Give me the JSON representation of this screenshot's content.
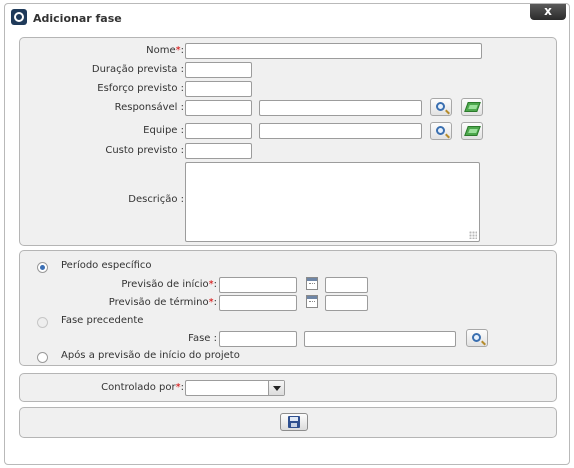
{
  "dialog": {
    "title": "Adicionar fase",
    "close_label": "x"
  },
  "form": {
    "nome_label": "Nome",
    "duracao_label": "Duração prevista :",
    "esforco_label": "Esforço previsto :",
    "responsavel_label": "Responsável :",
    "equipe_label": "Equipe :",
    "custo_label": "Custo previsto :",
    "descricao_label": "Descrição :",
    "required_mark": "*",
    "colon": ":"
  },
  "periodo": {
    "option_especifico": "Período específico",
    "inicio_label": "Previsão de início",
    "termino_label": "Previsão de término",
    "option_precedente": "Fase precedente",
    "fase_label": "Fase :",
    "option_apos": "Após a previsão de início do projeto",
    "selected": "Período específico"
  },
  "controle": {
    "controlado_label": "Controlado por",
    "selected_value": ""
  },
  "icons": {
    "app": "app-logo-icon",
    "search": "magnifier-icon",
    "clear": "eraser-icon",
    "calendar": "calendar-icon",
    "save": "floppy-disk-icon",
    "dropdown": "chevron-down-icon"
  },
  "colors": {
    "required": "#d40000",
    "radio_selected": "#3b6fb5",
    "panel_bg": "#f0f0f0"
  }
}
